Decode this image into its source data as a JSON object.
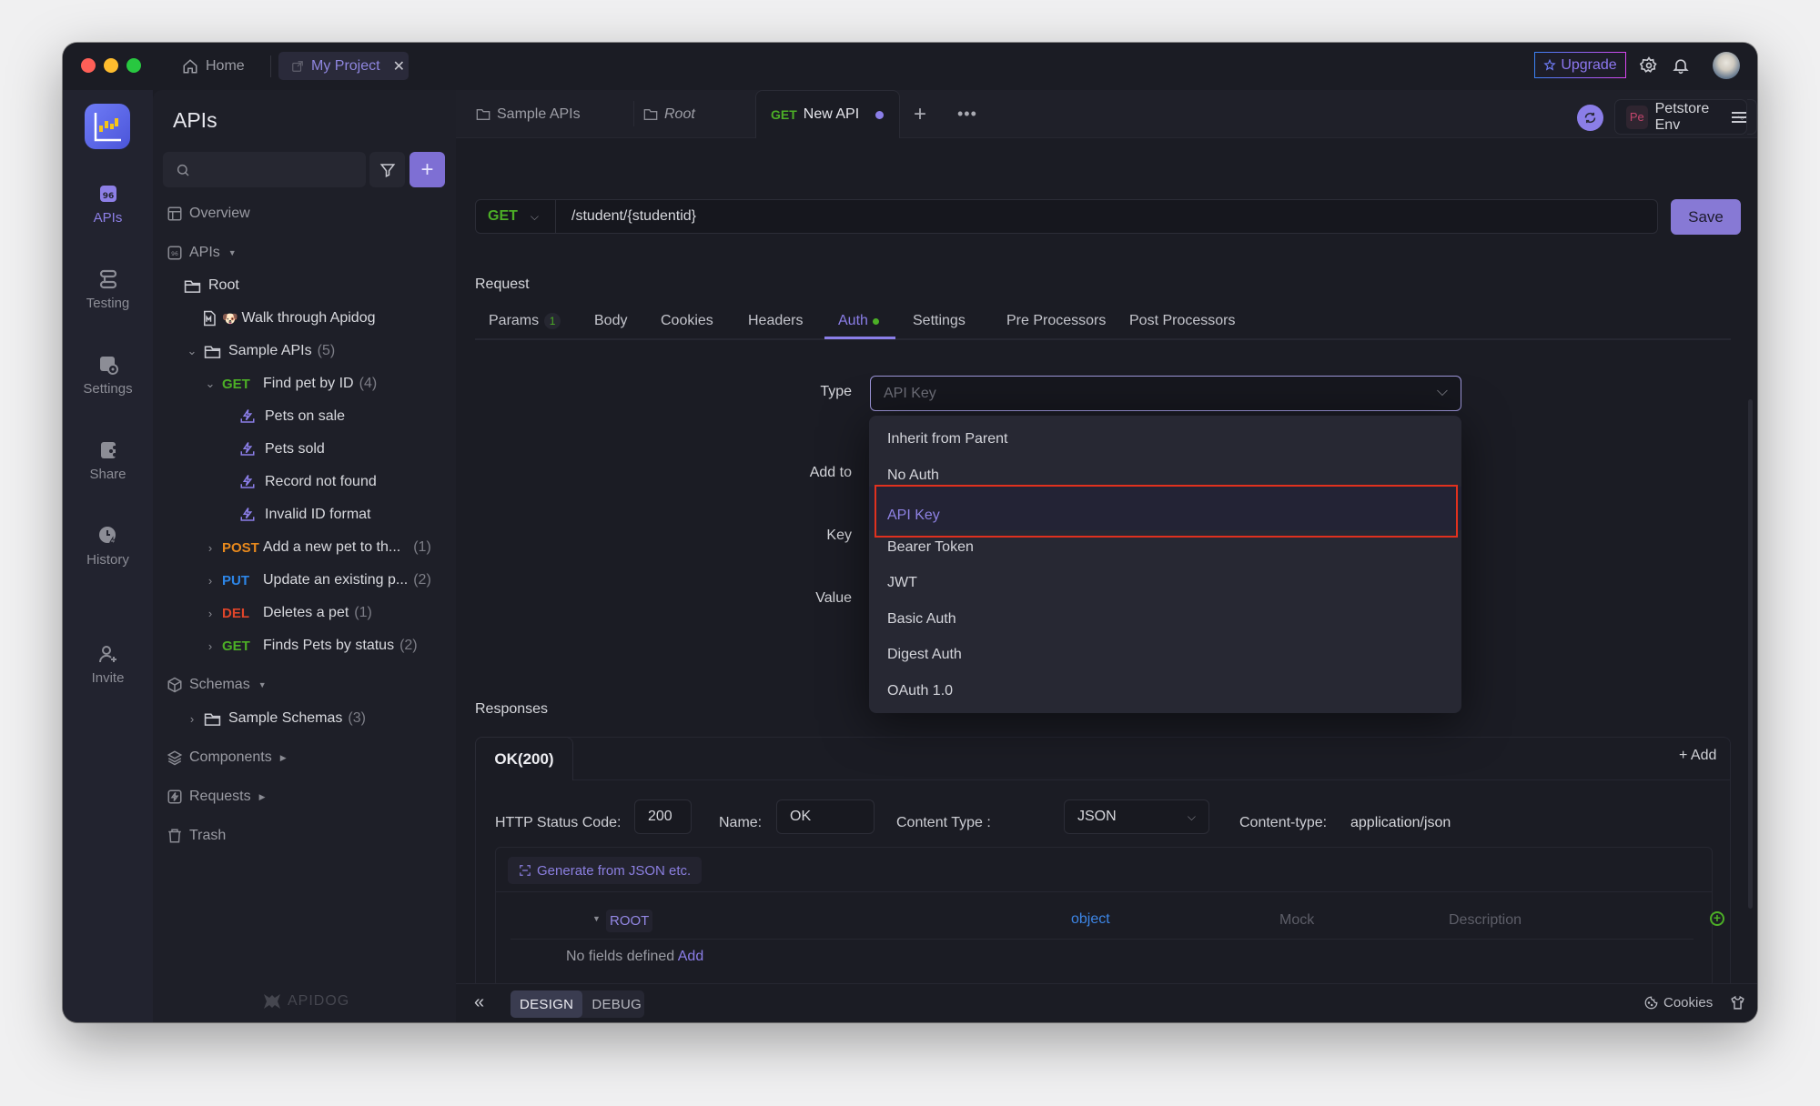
{
  "titlebar": {
    "home_label": "Home",
    "project_tab_label": "My Project",
    "upgrade_label": "Upgrade"
  },
  "rail": {
    "items": [
      {
        "label": "APIs",
        "active": true
      },
      {
        "label": "Testing"
      },
      {
        "label": "Settings"
      },
      {
        "label": "Share"
      },
      {
        "label": "History"
      },
      {
        "label": "Invite"
      }
    ]
  },
  "sidebar": {
    "title": "APIs",
    "search_placeholder": "",
    "overview": "Overview",
    "apis_section": "APIs",
    "root_folder": "Root",
    "walkthrough": "Walk through Apidog",
    "sample_apis": {
      "label": "Sample APIs",
      "count": "(5)"
    },
    "find_pet": {
      "method": "GET",
      "label": "Find pet by ID",
      "count": "(4)"
    },
    "cases": [
      "Pets on sale",
      "Pets sold",
      "Record not found",
      "Invalid ID format"
    ],
    "endpoints": [
      {
        "method": "POST",
        "label": "Add a new pet to th...",
        "count": "(1)"
      },
      {
        "method": "PUT",
        "label": "Update an existing p...",
        "count": "(2)"
      },
      {
        "method": "DEL",
        "label": "Deletes a pet",
        "count": "(1)"
      },
      {
        "method": "GET",
        "label": "Finds Pets by status",
        "count": "(2)"
      }
    ],
    "schemas": "Schemas",
    "sample_schemas": {
      "label": "Sample Schemas",
      "count": "(3)"
    },
    "components": "Components",
    "requests": "Requests",
    "trash": "Trash",
    "brand": "APIDOG"
  },
  "tabs": {
    "items": [
      {
        "label": "Sample APIs"
      },
      {
        "label": "Root"
      },
      {
        "method": "GET",
        "label": "New API",
        "active": true,
        "unsaved": true
      }
    ],
    "env_badge": "Pe",
    "env_label": "Petstore Env"
  },
  "request": {
    "method": "GET",
    "url": "/student/{studentid}",
    "save_label": "Save",
    "section_label": "Request",
    "tabs": [
      {
        "label": "Params",
        "badge": "1"
      },
      {
        "label": "Body"
      },
      {
        "label": "Cookies"
      },
      {
        "label": "Headers"
      },
      {
        "label": "Auth",
        "active": true,
        "dot": true
      },
      {
        "label": "Settings"
      },
      {
        "label": "Pre Processors"
      },
      {
        "label": "Post Processors"
      }
    ]
  },
  "auth": {
    "type_label": "Type",
    "add_to_label": "Add to",
    "key_label": "Key",
    "value_label": "Value",
    "type_value": "API Key",
    "options": [
      "Inherit from Parent",
      "No Auth",
      "API Key",
      "Bearer Token",
      "JWT",
      "Basic Auth",
      "Digest Auth",
      "OAuth 1.0"
    ],
    "selected_index": 2
  },
  "responses": {
    "label": "Responses",
    "tab_label": "OK(200)",
    "add_label": "Add",
    "status_code_label": "HTTP Status Code:",
    "status_code": "200",
    "name_label": "Name:",
    "name_value": "OK",
    "content_type_label": "Content Type :",
    "content_type_value": "JSON",
    "content_type_header_label": "Content-type:",
    "content_type_header_value": "application/json",
    "generate_label": "Generate from JSON etc.",
    "root_label": "ROOT",
    "root_type": "object",
    "mock_placeholder": "Mock",
    "description_placeholder": "Description",
    "no_fields_text": "No fields defined",
    "no_fields_add": "Add"
  },
  "bottombar": {
    "design_label": "DESIGN",
    "debug_label": "DEBUG",
    "cookies_label": "Cookies"
  },
  "colors": {
    "accent": "#8b7ee8",
    "get": "#4caf26",
    "post": "#e8891d",
    "put": "#2d86e8",
    "del": "#e0452a",
    "highlight_box": "#e0311e"
  }
}
